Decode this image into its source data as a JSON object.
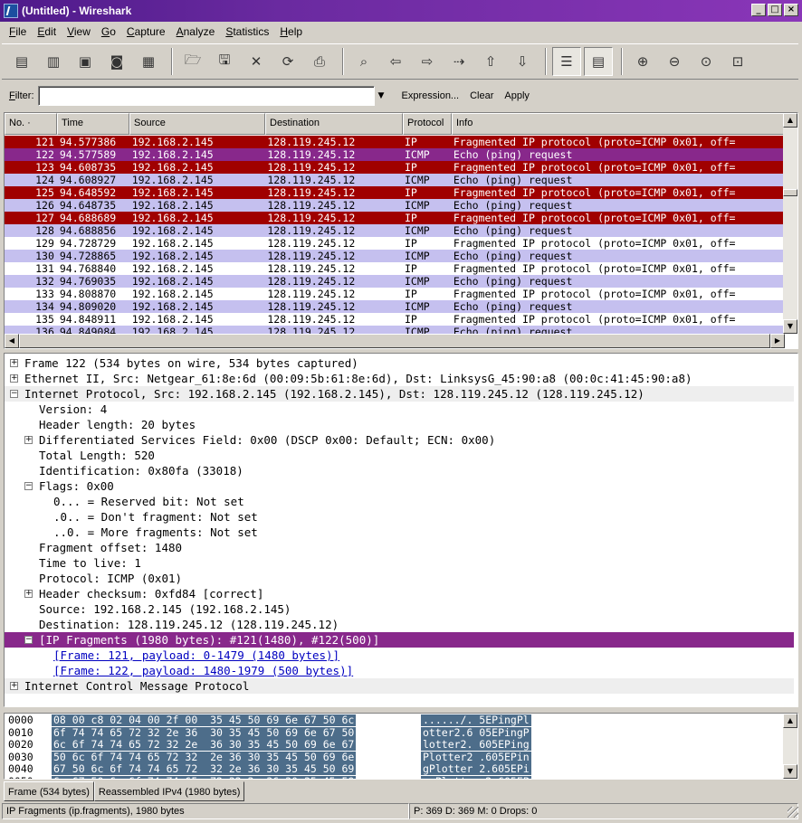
{
  "window": {
    "title": "(Untitled) - Wireshark",
    "buttons": [
      "_",
      "□",
      "×"
    ]
  },
  "menu": [
    "File",
    "Edit",
    "View",
    "Go",
    "Capture",
    "Analyze",
    "Statistics",
    "Help"
  ],
  "toolbar": {
    "icons": [
      {
        "name": "interfaces-icon",
        "glyph": "▤"
      },
      {
        "name": "capture-options-icon",
        "glyph": "▥"
      },
      {
        "name": "start-capture-icon",
        "glyph": "▣"
      },
      {
        "name": "stop-capture-icon",
        "glyph": "◙"
      },
      {
        "name": "restart-capture-icon",
        "glyph": "▦"
      },
      {
        "name": "sep"
      },
      {
        "name": "open-file-icon",
        "glyph": "🗁"
      },
      {
        "name": "save-file-icon",
        "glyph": "🖫"
      },
      {
        "name": "close-file-icon",
        "glyph": "✕"
      },
      {
        "name": "reload-icon",
        "glyph": "⟳"
      },
      {
        "name": "print-icon",
        "glyph": "⎙"
      },
      {
        "name": "sep"
      },
      {
        "name": "find-packet-icon",
        "glyph": "⌕"
      },
      {
        "name": "go-back-icon",
        "glyph": "⇦"
      },
      {
        "name": "go-forward-icon",
        "glyph": "⇨"
      },
      {
        "name": "go-to-packet-icon",
        "glyph": "⇢"
      },
      {
        "name": "go-first-icon",
        "glyph": "⇧"
      },
      {
        "name": "go-last-icon",
        "glyph": "⇩"
      },
      {
        "name": "sep"
      },
      {
        "name": "colorize-icon",
        "glyph": "☰",
        "pressed": true
      },
      {
        "name": "auto-scroll-icon",
        "glyph": "▤",
        "pressed": true
      },
      {
        "name": "sep"
      },
      {
        "name": "zoom-in-icon",
        "glyph": "⊕"
      },
      {
        "name": "zoom-out-icon",
        "glyph": "⊖"
      },
      {
        "name": "zoom-normal-icon",
        "glyph": "⊙"
      },
      {
        "name": "resize-columns-icon",
        "glyph": "⊡"
      }
    ]
  },
  "filter": {
    "label": "Filter:",
    "value": "",
    "expression": "Expression...",
    "clear": "Clear",
    "apply": "Apply"
  },
  "packet_list": {
    "columns": [
      "No. ·",
      "Time",
      "Source",
      "Destination",
      "Protocol",
      "Info"
    ],
    "colors": {
      "frag": "#a00000",
      "frag_text": "#ffffff",
      "icmp_sel": "#88288b",
      "icmp": "#c5c0ef"
    },
    "rows": [
      {
        "no": "121",
        "time": "94.577386",
        "src": "192.168.2.145",
        "dst": "128.119.245.12",
        "proto": "IP",
        "info": "Fragmented IP protocol (proto=ICMP 0x01, off=",
        "style": "frag"
      },
      {
        "no": "122",
        "time": "94.577589",
        "src": "192.168.2.145",
        "dst": "128.119.245.12",
        "proto": "ICMP",
        "info": "Echo (ping) request",
        "style": "sel"
      },
      {
        "no": "123",
        "time": "94.608735",
        "src": "192.168.2.145",
        "dst": "128.119.245.12",
        "proto": "IP",
        "info": "Fragmented IP protocol (proto=ICMP 0x01, off=",
        "style": "frag"
      },
      {
        "no": "124",
        "time": "94.608927",
        "src": "192.168.2.145",
        "dst": "128.119.245.12",
        "proto": "ICMP",
        "info": "Echo (ping) request",
        "style": "icmp"
      },
      {
        "no": "125",
        "time": "94.648592",
        "src": "192.168.2.145",
        "dst": "128.119.245.12",
        "proto": "IP",
        "info": "Fragmented IP protocol (proto=ICMP 0x01, off=",
        "style": "frag"
      },
      {
        "no": "126",
        "time": "94.648735",
        "src": "192.168.2.145",
        "dst": "128.119.245.12",
        "proto": "ICMP",
        "info": "Echo (ping) request",
        "style": "icmp"
      },
      {
        "no": "127",
        "time": "94.688689",
        "src": "192.168.2.145",
        "dst": "128.119.245.12",
        "proto": "IP",
        "info": "Fragmented IP protocol (proto=ICMP 0x01, off=",
        "style": "frag"
      },
      {
        "no": "128",
        "time": "94.688856",
        "src": "192.168.2.145",
        "dst": "128.119.245.12",
        "proto": "ICMP",
        "info": "Echo (ping) request",
        "style": "icmp"
      },
      {
        "no": "129",
        "time": "94.728729",
        "src": "192.168.2.145",
        "dst": "128.119.245.12",
        "proto": "IP",
        "info": "Fragmented IP protocol (proto=ICMP 0x01, off=",
        "style": "plain"
      },
      {
        "no": "130",
        "time": "94.728865",
        "src": "192.168.2.145",
        "dst": "128.119.245.12",
        "proto": "ICMP",
        "info": "Echo (ping) request",
        "style": "icmp"
      },
      {
        "no": "131",
        "time": "94.768840",
        "src": "192.168.2.145",
        "dst": "128.119.245.12",
        "proto": "IP",
        "info": "Fragmented IP protocol (proto=ICMP 0x01, off=",
        "style": "plain"
      },
      {
        "no": "132",
        "time": "94.769035",
        "src": "192.168.2.145",
        "dst": "128.119.245.12",
        "proto": "ICMP",
        "info": "Echo (ping) request",
        "style": "icmp"
      },
      {
        "no": "133",
        "time": "94.808870",
        "src": "192.168.2.145",
        "dst": "128.119.245.12",
        "proto": "IP",
        "info": "Fragmented IP protocol (proto=ICMP 0x01, off=",
        "style": "plain"
      },
      {
        "no": "134",
        "time": "94.809020",
        "src": "192.168.2.145",
        "dst": "128.119.245.12",
        "proto": "ICMP",
        "info": "Echo (ping) request",
        "style": "icmp"
      },
      {
        "no": "135",
        "time": "94.848911",
        "src": "192.168.2.145",
        "dst": "128.119.245.12",
        "proto": "IP",
        "info": "Fragmented IP protocol (proto=ICMP 0x01, off=",
        "style": "plain"
      },
      {
        "no": "136",
        "time": "94.849084",
        "src": "192.168.2.145",
        "dst": "128.119.245.12",
        "proto": "ICMP",
        "info": "Echo (ping) request",
        "style": "icmp"
      }
    ]
  },
  "details": [
    {
      "level": 0,
      "exp": "+",
      "text": "Frame 122 (534 bytes on wire, 534 bytes captured)"
    },
    {
      "level": 0,
      "exp": "+",
      "text": "Ethernet II, Src: Netgear_61:8e:6d (00:09:5b:61:8e:6d), Dst: LinksysG_45:90:a8 (00:0c:41:45:90:a8)"
    },
    {
      "level": 0,
      "exp": "-",
      "text": "Internet Protocol, Src: 192.168.2.145 (192.168.2.145), Dst: 128.119.245.12 (128.119.245.12)",
      "shade": true
    },
    {
      "level": 1,
      "exp": "",
      "text": "Version: 4"
    },
    {
      "level": 1,
      "exp": "",
      "text": "Header length: 20 bytes"
    },
    {
      "level": 1,
      "exp": "+",
      "text": "Differentiated Services Field: 0x00 (DSCP 0x00: Default; ECN: 0x00)"
    },
    {
      "level": 1,
      "exp": "",
      "text": "Total Length: 520"
    },
    {
      "level": 1,
      "exp": "",
      "text": "Identification: 0x80fa (33018)"
    },
    {
      "level": 1,
      "exp": "-",
      "text": "Flags: 0x00"
    },
    {
      "level": 2,
      "exp": "",
      "text": "0... = Reserved bit: Not set"
    },
    {
      "level": 2,
      "exp": "",
      "text": ".0.. = Don't fragment: Not set"
    },
    {
      "level": 2,
      "exp": "",
      "text": "..0. = More fragments: Not set"
    },
    {
      "level": 1,
      "exp": "",
      "text": "Fragment offset: 1480"
    },
    {
      "level": 1,
      "exp": "",
      "text": "Time to live: 1"
    },
    {
      "level": 1,
      "exp": "",
      "text": "Protocol: ICMP (0x01)"
    },
    {
      "level": 1,
      "exp": "+",
      "text": "Header checksum: 0xfd84 [correct]"
    },
    {
      "level": 1,
      "exp": "",
      "text": "Source: 192.168.2.145 (192.168.2.145)"
    },
    {
      "level": 1,
      "exp": "",
      "text": "Destination: 128.119.245.12 (128.119.245.12)"
    },
    {
      "level": 1,
      "exp": "-",
      "text": "[IP Fragments (1980 bytes): #121(1480), #122(500)]",
      "highlight": true
    },
    {
      "level": 2,
      "exp": "",
      "text": "[Frame: 121, payload: 0-1479 (1480 bytes)]",
      "link": true
    },
    {
      "level": 2,
      "exp": "",
      "text": "[Frame: 122, payload: 1480-1979 (500 bytes)]",
      "link": true
    },
    {
      "level": 0,
      "exp": "+",
      "text": "Internet Control Message Protocol",
      "shade": true
    }
  ],
  "hex": [
    {
      "off": "0000",
      "bytes": "08 00 c8 02 04 00 2f 00  35 45 50 69 6e 67 50 6c",
      "ascii": "....../. 5EPingPl"
    },
    {
      "off": "0010",
      "bytes": "6f 74 74 65 72 32 2e 36  30 35 45 50 69 6e 67 50",
      "ascii": "otter2.6 05EPingP"
    },
    {
      "off": "0020",
      "bytes": "6c 6f 74 74 65 72 32 2e  36 30 35 45 50 69 6e 67",
      "ascii": "lotter2. 605EPing"
    },
    {
      "off": "0030",
      "bytes": "50 6c 6f 74 74 65 72 32  2e 36 30 35 45 50 69 6e",
      "ascii": "Plotter2 .605EPin"
    },
    {
      "off": "0040",
      "bytes": "67 50 6c 6f 74 74 65 72  32 2e 36 30 35 45 50 69",
      "ascii": "gPlotter 2.605EPi"
    },
    {
      "off": "0050",
      "bytes": "6e 67 50 6c 6f 74 74 65  72 32 2e 36 30 35 45 50",
      "ascii": "ngPlotte r2.605EP"
    }
  ],
  "tabs": [
    "Frame (534 bytes)",
    "Reassembled IPv4 (1980 bytes)"
  ],
  "status": {
    "left": "IP Fragments (ip.fragments), 1980 bytes",
    "right": "P: 369 D: 369 M: 0 Drops: 0"
  }
}
